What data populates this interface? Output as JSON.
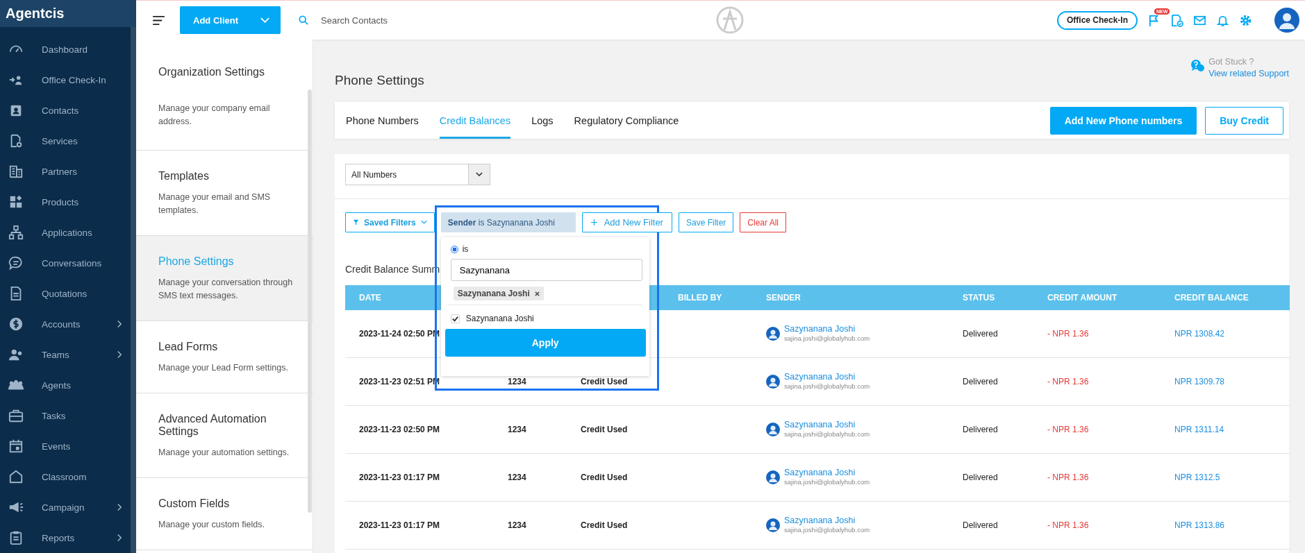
{
  "sidebar": {
    "brand": "Agentcis",
    "items": [
      {
        "label": "Dashboard",
        "has_submenu": false
      },
      {
        "label": "Office Check-In",
        "has_submenu": false
      },
      {
        "label": "Contacts",
        "has_submenu": false
      },
      {
        "label": "Services",
        "has_submenu": false
      },
      {
        "label": "Partners",
        "has_submenu": false
      },
      {
        "label": "Products",
        "has_submenu": false
      },
      {
        "label": "Applications",
        "has_submenu": false
      },
      {
        "label": "Conversations",
        "has_submenu": false
      },
      {
        "label": "Quotations",
        "has_submenu": false
      },
      {
        "label": "Accounts",
        "has_submenu": true
      },
      {
        "label": "Teams",
        "has_submenu": true
      },
      {
        "label": "Agents",
        "has_submenu": false
      },
      {
        "label": "Tasks",
        "has_submenu": false
      },
      {
        "label": "Events",
        "has_submenu": false
      },
      {
        "label": "Classroom",
        "has_submenu": false
      },
      {
        "label": "Campaign",
        "has_submenu": true
      },
      {
        "label": "Reports",
        "has_submenu": true
      }
    ]
  },
  "topbar": {
    "add_button": "Add Client",
    "search": {
      "placeholder": "Search Contacts"
    },
    "checkin_button": "Office Check-In",
    "new_badge": "NEW"
  },
  "settings_menu": [
    {
      "title": "Organization Settings",
      "description": "Manage your company email address.",
      "selected": false
    },
    {
      "title": "Templates",
      "description": "Manage your email and SMS templates.",
      "selected": false
    },
    {
      "title": "Phone Settings",
      "description": "Manage your conversation through SMS text messages.",
      "selected": true
    },
    {
      "title": "Lead Forms",
      "description": "Manage your Lead Form settings.",
      "selected": false
    },
    {
      "title": "Advanced Automation Settings",
      "description": "Manage your automation settings.",
      "selected": false
    },
    {
      "title": "Custom Fields",
      "description": "Manage your custom fields.",
      "selected": false
    }
  ],
  "page": {
    "title": "Phone Settings",
    "help": {
      "question": "Got Stuck ?",
      "link": "View related Support"
    }
  },
  "tabs": [
    {
      "label": "Phone Numbers",
      "selected": false
    },
    {
      "label": "Credit Balances",
      "selected": true
    },
    {
      "label": "Logs",
      "selected": false
    },
    {
      "label": "Regulatory Compliance",
      "selected": false
    }
  ],
  "actions": [
    {
      "label": "Add New Phone numbers",
      "kind": "primary"
    },
    {
      "label": "Buy Credit",
      "kind": "outline"
    }
  ],
  "number_select": {
    "value": "All Numbers"
  },
  "filters": [
    {
      "label": "Saved Filters",
      "kind": "saved"
    },
    {
      "label": "**Sender** is Sazynanana Joshi",
      "kind": "chip"
    },
    {
      "label": "Add New Filter",
      "kind": "add"
    },
    {
      "label": "Save Filter",
      "kind": "plain"
    },
    {
      "label": "Clear All",
      "kind": "danger"
    }
  ],
  "filter_popup": {
    "options": [
      {
        "label": "is",
        "selected": true
      }
    ],
    "input": {
      "value": "Sazynanana"
    },
    "tags": [
      "Sazynanana Joshi"
    ],
    "results": [
      {
        "label": "Sazynanana Joshi",
        "checked": true
      }
    ],
    "apply": "Apply"
  },
  "summary_title": "Credit Balance Summ",
  "table": {
    "columns": [
      {
        "label": "DATE"
      },
      {},
      {},
      {
        "label": "BILLED BY"
      },
      {
        "label": "SENDER"
      },
      {
        "label": "STATUS"
      },
      {
        "label": "CREDIT AMOUNT"
      },
      {
        "label": "CREDIT BALANCE"
      }
    ],
    "rows": [
      {
        "date": "2023-11-24 02:50 PM",
        "sender": "Sazynanana Joshi",
        "email": "sajina.joshi@globalyhub.com",
        "status": "Delivered",
        "amount": "- NPR 1.36",
        "balance": "NPR 1308.42"
      },
      {
        "date": "2023-11-23 02:51 PM",
        "number": "1234",
        "type": "Credit Used",
        "sender": "Sazynanana Joshi",
        "email": "sajina.joshi@globalyhub.com",
        "status": "Delivered",
        "amount": "- NPR 1.36",
        "balance": "NPR 1309.78"
      },
      {
        "date": "2023-11-23 02:50 PM",
        "number": "1234",
        "type": "Credit Used",
        "sender": "Sazynanana Joshi",
        "email": "sajina.joshi@globalyhub.com",
        "status": "Delivered",
        "amount": "- NPR 1.36",
        "balance": "NPR 1311.14"
      },
      {
        "date": "2023-11-23 01:17 PM",
        "number": "1234",
        "type": "Credit Used",
        "sender": "Sazynanana Joshi",
        "email": "sajina.joshi@globalyhub.com",
        "status": "Delivered",
        "amount": "- NPR 1.36",
        "balance": "NPR 1312.5"
      },
      {
        "date": "2023-11-23 01:17 PM",
        "number": "1234",
        "type": "Credit Used",
        "sender": "Sazynanana Joshi",
        "email": "sajina.joshi@globalyhub.com",
        "status": "Delivered",
        "amount": "- NPR 1.36",
        "balance": "NPR 1313.86"
      }
    ]
  }
}
